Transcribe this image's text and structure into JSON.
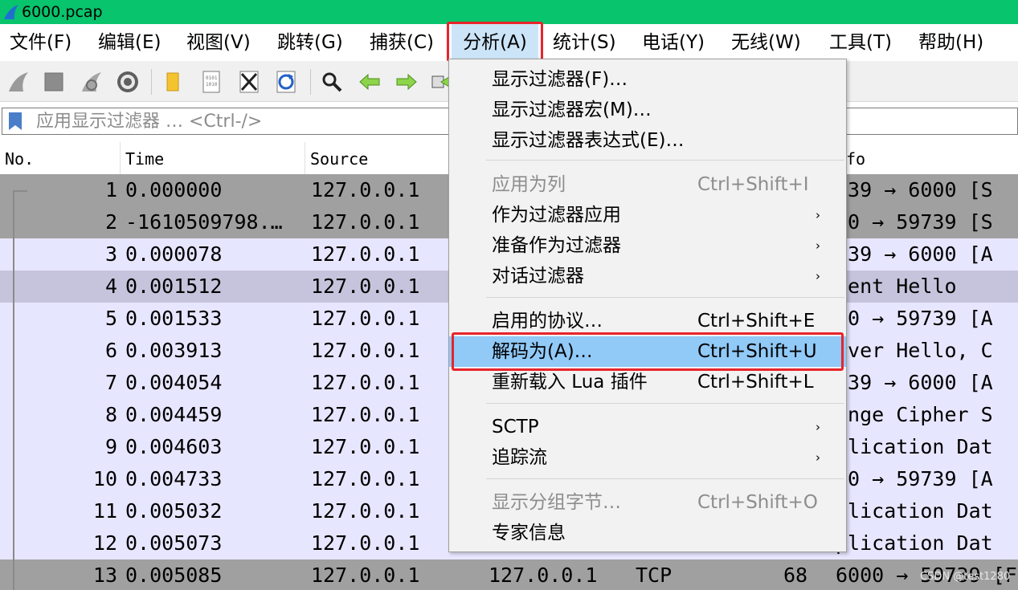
{
  "window": {
    "title": "6000.pcap"
  },
  "menubar": {
    "items": [
      {
        "label": "文件(F)"
      },
      {
        "label": "编辑(E)"
      },
      {
        "label": "视图(V)"
      },
      {
        "label": "跳转(G)"
      },
      {
        "label": "捕获(C)"
      },
      {
        "label": "分析(A)",
        "active": true
      },
      {
        "label": "统计(S)"
      },
      {
        "label": "电话(Y)"
      },
      {
        "label": "无线(W)"
      },
      {
        "label": "工具(T)"
      },
      {
        "label": "帮助(H)"
      }
    ]
  },
  "toolbar": {
    "icons": [
      "shark-fin-start-icon",
      "stop-square-icon",
      "shark-fin-restart-icon",
      "capture-options-gear-icon",
      "open-folder-icon",
      "save-file-icon",
      "close-file-icon",
      "reload-icon",
      "find-magnifier-icon",
      "go-back-arrow-icon",
      "go-forward-arrow-icon",
      "go-to-packet-icon"
    ]
  },
  "filter": {
    "placeholder": "应用显示过滤器 … <Ctrl-/>"
  },
  "packet_list": {
    "columns": [
      "No.",
      "Time",
      "Source",
      "fo"
    ],
    "rows": [
      {
        "no": "1",
        "time": "0.000000",
        "src": "127.0.0.1",
        "info": "739 → 6000 [S"
      },
      {
        "no": "2",
        "time": "-1610509798.…",
        "src": "127.0.0.1",
        "info": "00 → 59739 [S"
      },
      {
        "no": "3",
        "time": "0.000078",
        "src": "127.0.0.1",
        "info": "739 → 6000 [A"
      },
      {
        "no": "4",
        "time": "0.001512",
        "src": "127.0.0.1",
        "info": "ient Hello"
      },
      {
        "no": "5",
        "time": "0.001533",
        "src": "127.0.0.1",
        "info": "00 → 59739 [A"
      },
      {
        "no": "6",
        "time": "0.003913",
        "src": "127.0.0.1",
        "info": "rver Hello, C"
      },
      {
        "no": "7",
        "time": "0.004054",
        "src": "127.0.0.1",
        "info": "739 → 6000 [A"
      },
      {
        "no": "8",
        "time": "0.004459",
        "src": "127.0.0.1",
        "info": "ange Cipher S"
      },
      {
        "no": "9",
        "time": "0.004603",
        "src": "127.0.0.1",
        "info": "plication Dat"
      },
      {
        "no": "10",
        "time": "0.004733",
        "src": "127.0.0.1",
        "info": "00 → 59739 [A"
      },
      {
        "no": "11",
        "time": "0.005032",
        "src": "127.0.0.1",
        "info": "plication Dat"
      },
      {
        "no": "12",
        "time": "0.005073",
        "src": "127.0.0.1",
        "info": "plication Dat"
      },
      {
        "no": "13",
        "time": "0.005085",
        "src": "127.0.0.1",
        "dst": "127.0.0.1",
        "proto": "TCP",
        "len": "68",
        "info": "6000 → 59739 [F"
      }
    ]
  },
  "analyze_menu": {
    "items": [
      {
        "label": "显示过滤器(F)…"
      },
      {
        "label": "显示过滤器宏(M)…"
      },
      {
        "label": "显示过滤器表达式(E)…"
      },
      {
        "label": "应用为列",
        "shortcut": "Ctrl+Shift+I",
        "disabled": true
      },
      {
        "label": "作为过滤器应用",
        "submenu": "›"
      },
      {
        "label": "准备作为过滤器",
        "submenu": "›"
      },
      {
        "label": "对话过滤器",
        "submenu": "›"
      },
      {
        "label": "启用的协议…",
        "shortcut": "Ctrl+Shift+E"
      },
      {
        "label": "解码为(A)…",
        "shortcut": "Ctrl+Shift+U",
        "hovered": true
      },
      {
        "label": "重新载入 Lua 插件",
        "shortcut": "Ctrl+Shift+L"
      },
      {
        "label": "SCTP",
        "submenu": "›"
      },
      {
        "label": "追踪流",
        "submenu": "›"
      },
      {
        "label": "显示分组字节…",
        "shortcut": "Ctrl+Shift+O",
        "disabled": true
      },
      {
        "label": "专家信息"
      }
    ]
  },
  "watermark": "CSDN @test1280",
  "colors": {
    "title_bar": "#08c46c",
    "highlight_frame": "#e8242b",
    "row_gray": "#a0a0a0",
    "row_lavender": "#e7e6ff",
    "row_dark_lavender": "#c6c4dc",
    "menu_hover": "#91c9f7"
  }
}
